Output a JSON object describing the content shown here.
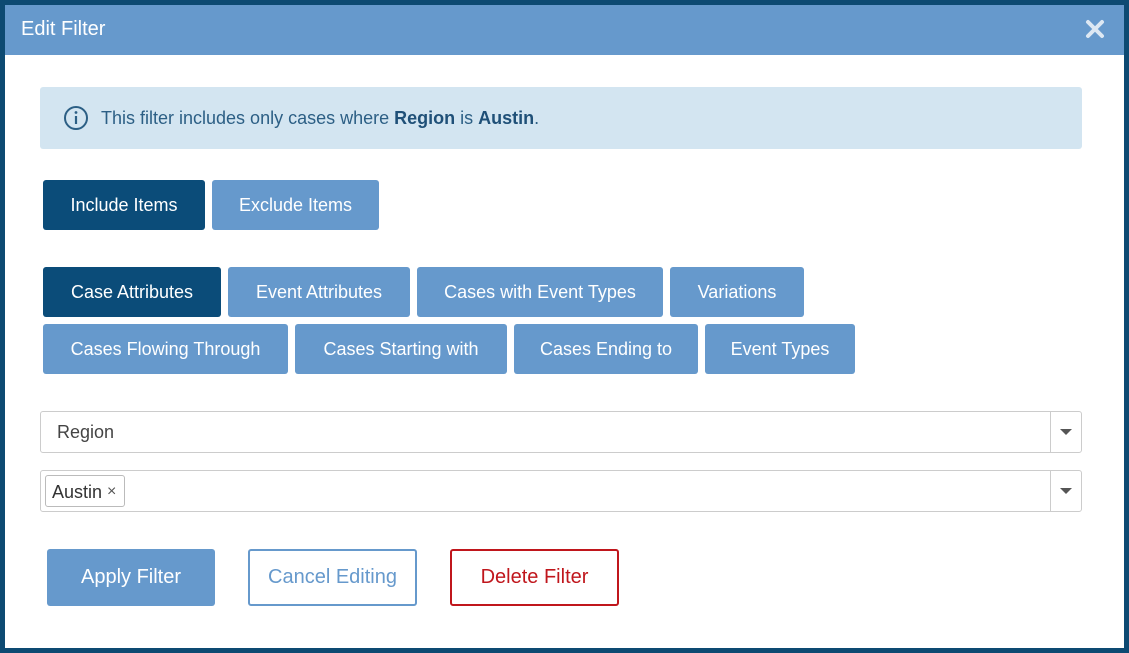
{
  "dialog": {
    "title": "Edit Filter",
    "close_icon": "close-icon"
  },
  "info": {
    "prefix": "This filter includes only cases where ",
    "attribute": "Region",
    "middle": " is ",
    "value": "Austin",
    "suffix": "."
  },
  "mode_tabs": [
    {
      "label": "Include Items",
      "active": true
    },
    {
      "label": "Exclude Items",
      "active": false
    }
  ],
  "filter_types": [
    {
      "label": "Case Attributes",
      "active": true
    },
    {
      "label": "Event Attributes",
      "active": false
    },
    {
      "label": "Cases with Event Types",
      "active": false
    },
    {
      "label": "Variations",
      "active": false
    },
    {
      "label": "Cases Flowing Through",
      "active": false
    },
    {
      "label": "Cases Starting with",
      "active": false
    },
    {
      "label": "Cases Ending to",
      "active": false
    },
    {
      "label": "Event Types",
      "active": false
    }
  ],
  "attribute_select": {
    "value": "Region"
  },
  "value_select": {
    "chips": [
      {
        "label": "Austin",
        "remove": "×"
      }
    ]
  },
  "actions": {
    "apply": "Apply Filter",
    "cancel": "Cancel Editing",
    "delete": "Delete Filter"
  },
  "colors": {
    "header": "#6699cc",
    "active_button": "#0b4c79",
    "inactive_button": "#6699cc",
    "info_background": "#d3e5f1",
    "danger": "#c0161c"
  }
}
